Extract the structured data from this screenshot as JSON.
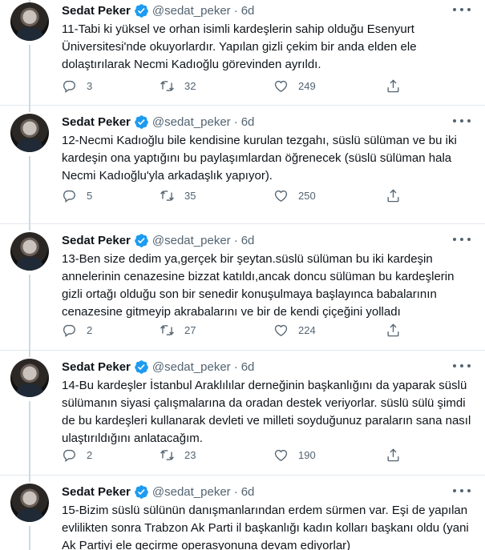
{
  "tweets": [
    {
      "name": "Sedat Peker",
      "handle": "@sedat_peker",
      "separator": "·",
      "time": "6d",
      "text": "11-Tabi ki yüksel ve orhan isimli kardeşlerin sahip olduğu Esenyurt\nÜniversitesi'nde okuyorlardır. Yapılan gizli çekim bir anda elden ele\ndolaştırılarak Necmi Kadıoğlu görevinden ayrıldı.",
      "replies": "3",
      "retweets": "32",
      "likes": "249"
    },
    {
      "name": "Sedat Peker",
      "handle": "@sedat_peker",
      "separator": "·",
      "time": "6d",
      "text": "12-Necmi Kadıoğlu bile kendisine kurulan tezgahı, süslü sülüman ve bu iki\nkardeşin ona yaptığını bu paylaşımlardan öğrenecek (süslü sülüman hala\nNecmi Kadıoğlu'yla arkadaşlık yapıyor).",
      "replies": "5",
      "retweets": "35",
      "likes": "250"
    },
    {
      "name": "Sedat Peker",
      "handle": "@sedat_peker",
      "separator": "·",
      "time": "6d",
      "text": "13-Ben size dedim ya,gerçek bir şeytan.süslü sülüman bu iki kardeşin\nannelerinin cenazesine bizzat katıldı,ancak doncu sülüman bu kardeşlerin\ngizli ortağı olduğu son bir senedir konuşulmaya başlayınca babalarının\ncenazesine gitmeyip akrabalarını ve bir de kendi çiçeğini yolladı",
      "replies": "2",
      "retweets": "27",
      "likes": "224"
    },
    {
      "name": "Sedat Peker",
      "handle": "@sedat_peker",
      "separator": "·",
      "time": "6d",
      "text": "14-Bu kardeşler İstanbul Araklılılar derneğinin başkanlığını da yaparak süslü\nsülümanın siyasi çalışmalarına da oradan destek veriyorlar. süslü sülü şimdi\nde bu kardeşleri kullanarak devleti ve milleti soyduğunuz paraların sana nasıl\nulaştırıldığını anlatacağım.",
      "replies": "2",
      "retweets": "23",
      "likes": "190"
    },
    {
      "name": "Sedat Peker",
      "handle": "@sedat_peker",
      "separator": "·",
      "time": "6d",
      "text": "15-Bizim süslü sülünün danışmanlarından erdem sürmen var. Eşi de yapılan\nevlilikten sonra Trabzon Ak Parti il başkanlığı kadın kolları başkanı oldu (yani\nAk Partiyi ele geçirme operasyonuna devam ediyorlar)",
      "replies": "",
      "retweets": "",
      "likes": ""
    }
  ],
  "icons": {
    "verified": "verified-badge-icon",
    "more": "more-options-icon",
    "reply": "reply-icon",
    "retweet": "retweet-icon",
    "like": "like-icon",
    "share": "share-icon"
  },
  "colors": {
    "verified": "#1d9bf0",
    "text": "#0f1419",
    "secondary": "#536471",
    "divider": "#e1e8ed",
    "thread_line": "#cfd9de"
  }
}
